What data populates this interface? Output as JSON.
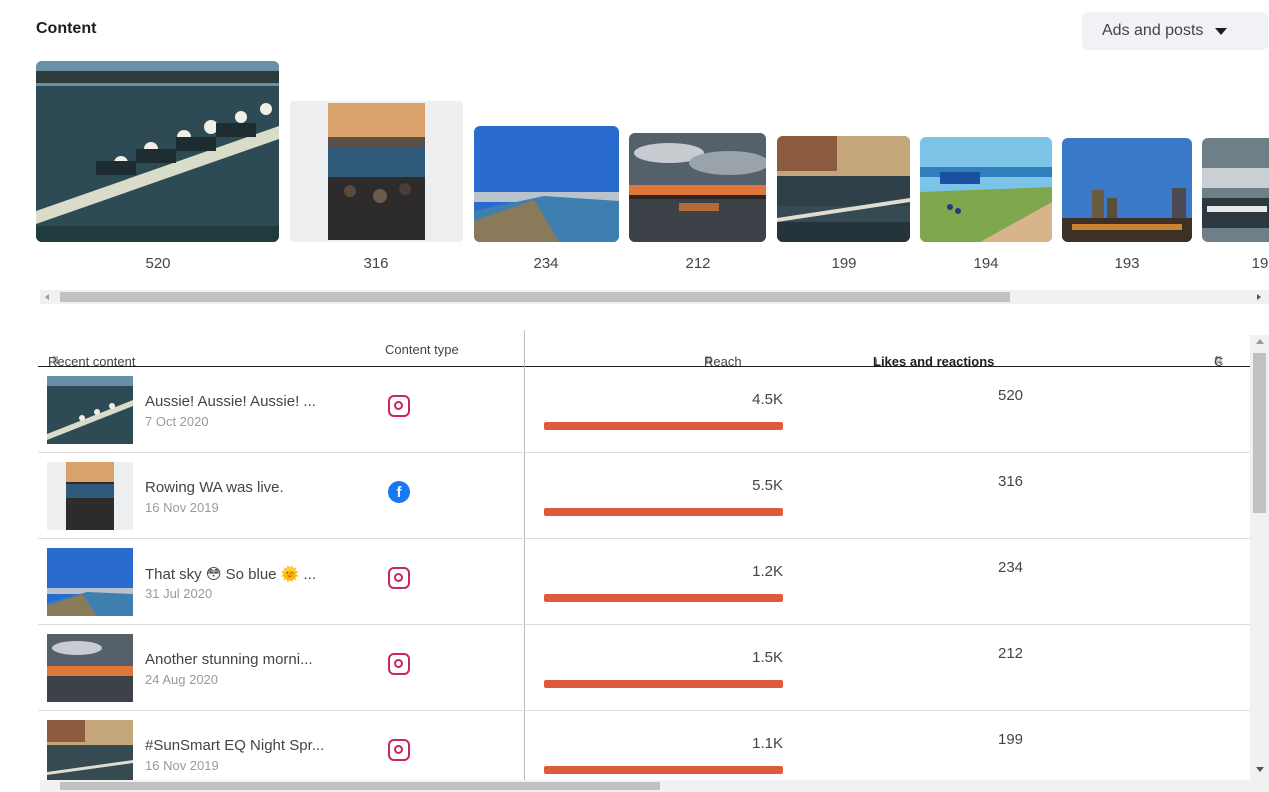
{
  "section_title": "Content",
  "filter": {
    "label": "Ads and posts"
  },
  "thumbnails": [
    {
      "count": "520"
    },
    {
      "count": "316"
    },
    {
      "count": "234"
    },
    {
      "count": "212"
    },
    {
      "count": "199"
    },
    {
      "count": "194"
    },
    {
      "count": "193"
    },
    {
      "count": "19"
    }
  ],
  "table": {
    "columns": {
      "recent_content": "Recent content",
      "content_type": "Content type",
      "reach": "Reach",
      "likes": "Likes and reactions",
      "partial": "C"
    },
    "rows": [
      {
        "text": "Aussie! Aussie! Aussie! ...",
        "date": "7 Oct 2020",
        "type": "instagram-icon",
        "reach": "4.5K",
        "likes": "520"
      },
      {
        "text": "Rowing WA was live.",
        "date": "16 Nov 2019",
        "type": "facebook-icon",
        "reach": "5.5K",
        "likes": "316"
      },
      {
        "text": "That sky 😳 So blue 🌞 ...",
        "date": "31 Jul 2020",
        "type": "instagram-icon",
        "reach": "1.2K",
        "likes": "234"
      },
      {
        "text": "Another stunning morni...",
        "date": "24 Aug 2020",
        "type": "instagram-icon",
        "reach": "1.5K",
        "likes": "212"
      },
      {
        "text": "#SunSmart EQ Night Spr...",
        "date": "16 Nov 2019",
        "type": "instagram-icon",
        "reach": "1.1K",
        "likes": "199"
      }
    ]
  },
  "colors": {
    "reach_bar": "#dd5a3c",
    "instagram": "#c7265f",
    "facebook": "#1877f2"
  }
}
